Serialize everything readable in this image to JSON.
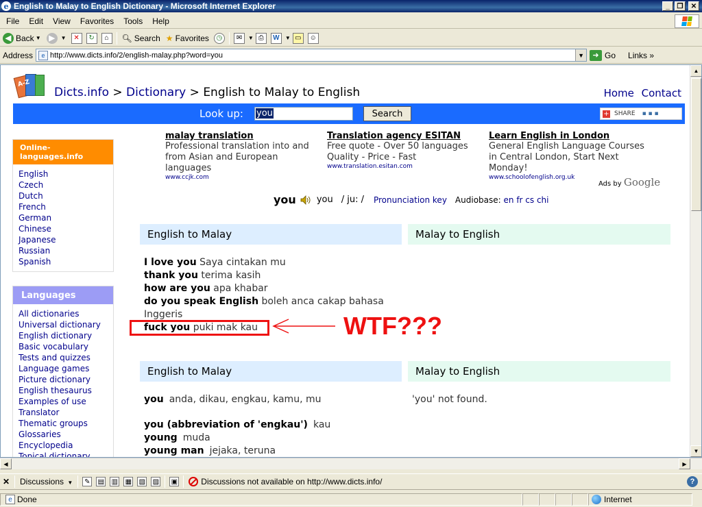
{
  "window": {
    "title": "English to Malay to English Dictionary - Microsoft Internet Explorer"
  },
  "menu": [
    "File",
    "Edit",
    "View",
    "Favorites",
    "Tools",
    "Help"
  ],
  "toolbar": {
    "back": "Back",
    "search": "Search",
    "favorites": "Favorites"
  },
  "address": {
    "label": "Address",
    "url": "http://www.dicts.info/2/english-malay.php?word=you",
    "go": "Go",
    "links": "Links"
  },
  "page": {
    "breadcrumb": {
      "site": "Dicts.info",
      "sep1": " > ",
      "dictionary": "Dictionary",
      "sep2": " > ",
      "current": "English to Malay to English"
    },
    "toplinks": {
      "home": "Home",
      "contact": "Contact"
    },
    "lookup": {
      "label": "Look up:",
      "value": "you",
      "button": "Search",
      "share": "SHARE"
    },
    "ads": [
      {
        "title": "malay translation",
        "desc": "Professional translation into and from Asian and European languages",
        "url": "www.ccjk.com"
      },
      {
        "title": "Translation agency ESITAN",
        "desc": "Free quote - Over 50 languages Quality - Price - Fast",
        "url": "www.translation.esitan.com"
      },
      {
        "title": "Learn English in London",
        "desc": "General English Language Courses in Central London, Start Next Monday!",
        "url": "www.schoolofenglish.org.uk"
      }
    ],
    "ads_by": "Ads by",
    "ads_brand": "Google",
    "pronunciation": {
      "word": "you",
      "word2": "you",
      "ipa": "/ ju: /",
      "key": "Pronunciation key",
      "audiobase_label": "Audiobase:",
      "audiobase_langs": "en fr cs chi"
    },
    "sidebar": {
      "box1_title": "Online-languages.info",
      "box1_items": [
        "English",
        "Czech",
        "Dutch",
        "French",
        "German",
        "Chinese",
        "Japanese",
        "Russian",
        "Spanish"
      ],
      "box2_title": "Languages",
      "box2_items": [
        "All dictionaries",
        "Universal dictionary",
        "English dictionary",
        "Basic vocabulary",
        "Tests and quizzes",
        "Language games",
        "Picture dictionary",
        "English thesaurus",
        "Examples of use",
        "Translator",
        "Thematic groups",
        "Glossaries",
        "Encyclopedia",
        "Topical dictionary"
      ]
    },
    "panels": {
      "en_ms": "English to Malay",
      "ms_en": "Malay to English"
    },
    "phrases": [
      {
        "en": "I love you",
        "ms": "Saya cintakan mu"
      },
      {
        "en": "thank you",
        "ms": "terima kasih"
      },
      {
        "en": "how are you",
        "ms": "apa khabar"
      },
      {
        "en": "do you speak English",
        "ms": "boleh anca cakap bahasa"
      },
      {
        "en": "",
        "ms": "Inggeris"
      },
      {
        "en": "fuck you",
        "ms": "puki mak kau"
      }
    ],
    "annotation": "WTF???",
    "words": [
      {
        "en": "you",
        "ms": "anda, dikau, engkau, kamu, mu"
      },
      {
        "en": "you (abbreviation of 'engkau')",
        "ms": "kau"
      },
      {
        "en": "young",
        "ms": "muda"
      },
      {
        "en": "young man",
        "ms": "jejaka, teruna"
      }
    ],
    "not_found": "'you' not found."
  },
  "discussions": {
    "label": "Discussions",
    "message": "Discussions not available on http://www.dicts.info/"
  },
  "status": {
    "text": "Done",
    "zone": "Internet"
  }
}
